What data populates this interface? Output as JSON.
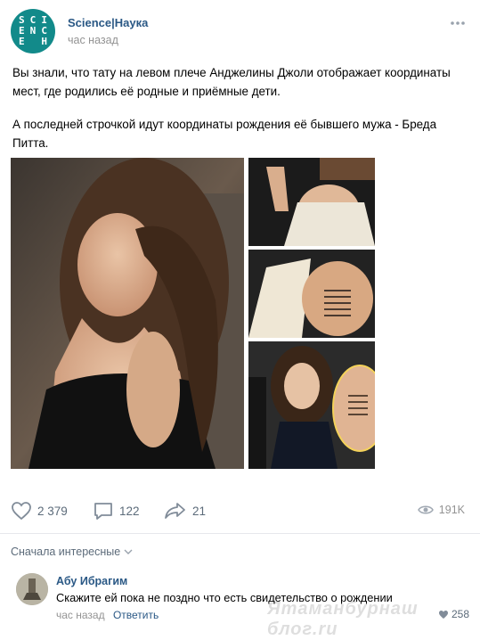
{
  "post": {
    "group_name": "Science|Наука",
    "time": "час назад",
    "logo_letters": [
      "S",
      "C",
      "I",
      "E",
      "N",
      "C",
      "E",
      "",
      "H"
    ],
    "paragraph_1": "Вы знали, что тату на левом плече Анджелины Джоли отображает координаты мест, где родились её родные и приёмные дети.",
    "paragraph_2": "А последней строчкой идут координаты рождения её бывшего мужа - Бреда Питта."
  },
  "actions": {
    "likes": "2 379",
    "comments": "122",
    "shares": "21",
    "views": "191K"
  },
  "comments_sort": "Сначала интересные",
  "comment": {
    "author": "Абу Ибрагим",
    "text": "Скажите ей пока не поздно что есть свидетельство о рождении",
    "time": "час назад",
    "reply": "Ответить",
    "likes": "258"
  },
  "watermark": "Ятаманбурнаш блог.ru",
  "colors": {
    "link": "#2a5885",
    "muted": "#939393",
    "action": "#5c6b7a",
    "logo_bg": "#128a8a"
  }
}
